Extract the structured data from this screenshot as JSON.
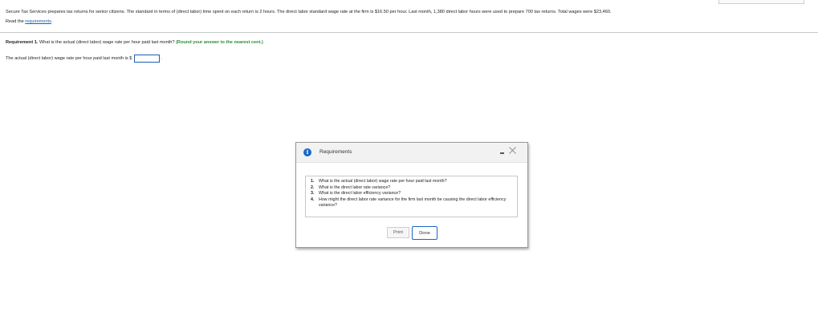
{
  "problem": {
    "text": "Secure Tax Services prepares tax returns for senior citizens. The standard in terms of (direct labor) time spent on each return is 2 hours. The direct labor standard wage rate at the firm is $16.50 per hour. Last month, 1,380 direct labor hours were used to prepare 700 tax returns. Total wages were $23,460.",
    "read_prefix": "Read the ",
    "read_link": "requirements",
    "read_suffix": "."
  },
  "requirement": {
    "label": "Requirement 1.",
    "question": " What is the actual (direct labor) wage rate per hour paid last month? ",
    "hint": "(Round your answer to the nearest cent.)",
    "answer_prompt": "The actual (direct labor) wage rate per hour paid last month is $",
    "answer_value": "",
    "answer_suffix": "."
  },
  "dialog": {
    "title": "Requirements",
    "info_icon_glyph": "i",
    "icons": {
      "info": "info-icon",
      "minimize": "minimize-icon",
      "close": "close-icon"
    },
    "items": [
      {
        "num": "1.",
        "text": "What is the actual (direct labor) wage rate per hour paid last month?"
      },
      {
        "num": "2.",
        "text": "What is the direct labor rate variance?"
      },
      {
        "num": "3.",
        "text": "What is the direct labor efficiency variance?"
      },
      {
        "num": "4.",
        "text": "How might the direct labor rate variance for the firm last month be causing the direct labor efficiency variance?"
      }
    ],
    "print_label": "Print",
    "done_label": "Done"
  },
  "colors": {
    "link": "#1a5fb4",
    "hint": "#2e8b3d",
    "accent": "#1a67c7"
  }
}
